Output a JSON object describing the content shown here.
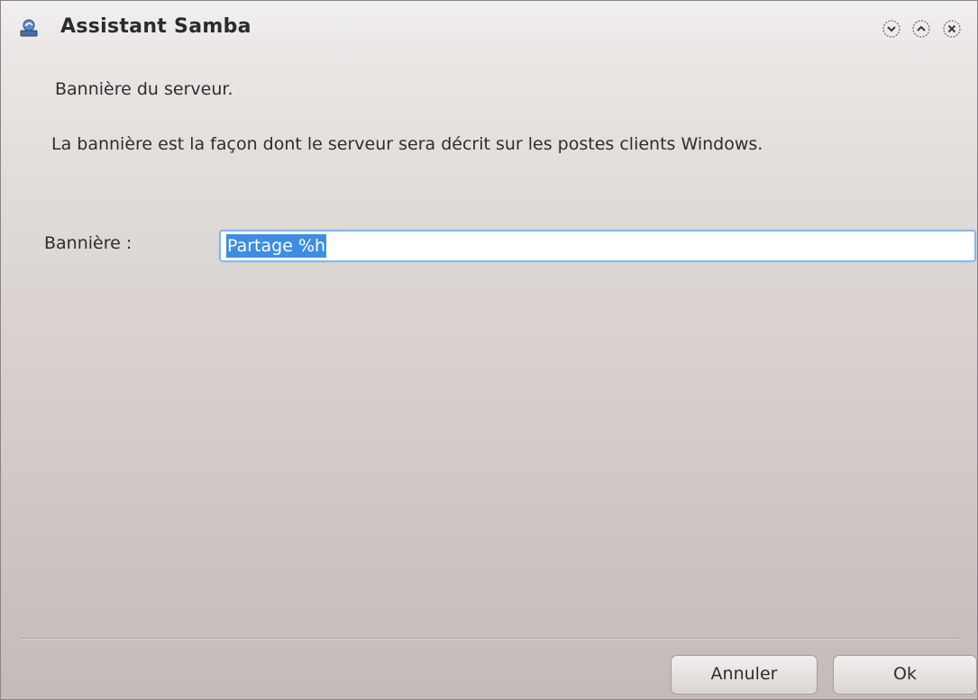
{
  "window": {
    "title": "Assistant Samba",
    "icon": "samba-wizard-icon"
  },
  "window_controls": [
    "minimize-icon",
    "maximize-icon",
    "close-icon"
  ],
  "content": {
    "heading": "Bannière du serveur.",
    "description": "La bannière est la façon dont le serveur sera décrit sur les postes clients Windows.",
    "banner_field": {
      "label": "Bannière :",
      "value": "Partage %h",
      "selected": true
    }
  },
  "buttons": {
    "cancel_label": "Annuler",
    "ok_label": "Ok"
  },
  "colors": {
    "selection": "#3d8ee3",
    "input_focus_border": "#84b9e6"
  }
}
